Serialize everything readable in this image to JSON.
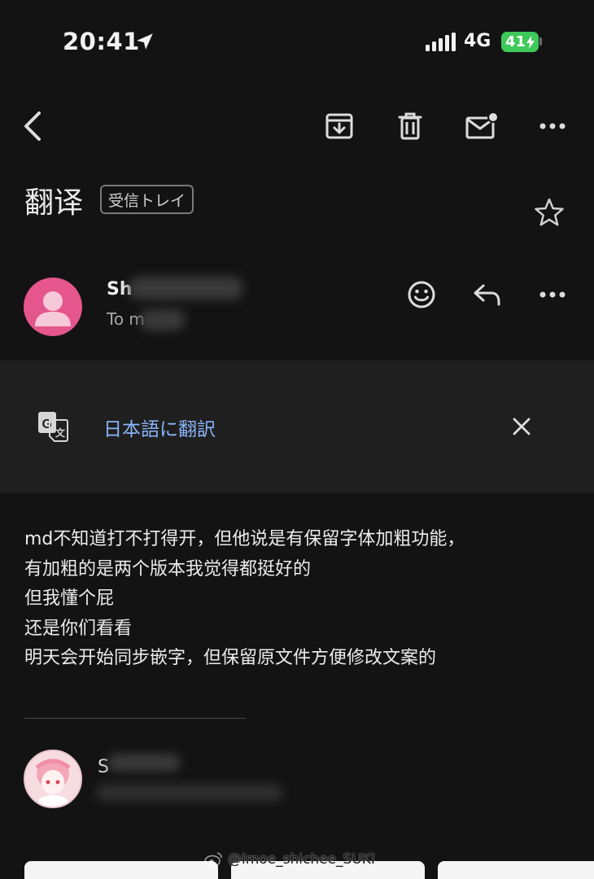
{
  "status_bar": {
    "time": "20:41",
    "network": "4G",
    "battery": "41"
  },
  "toolbar": {
    "back": "back-icon",
    "archive": "archive-icon",
    "delete": "trash-icon",
    "mark_unread": "mark-unread-icon",
    "more": "more-icon"
  },
  "email": {
    "subject": "翻译",
    "label": "受信トレイ",
    "sender_name": "Sh",
    "sender_to": "To m"
  },
  "translate": {
    "link_label": "日本語に翻訳"
  },
  "body": {
    "lines": [
      "md不知道打不打得开，但他说是有保留字体加粗功能，",
      "有加粗的是两个版本我觉得都挺好的",
      "但我懂个屁",
      "还是你们看看",
      "明天会开始同步嵌字，但保留原文件方便修改文案的"
    ]
  },
  "reply": {
    "sender_initial": "S"
  },
  "watermark": "@lmoe_shichee_SUKI",
  "colors": {
    "background": "#131313",
    "banner": "#1f1f1f",
    "link": "#8ab4f8",
    "avatar": "#e5568c",
    "battery": "#3ec95a"
  }
}
